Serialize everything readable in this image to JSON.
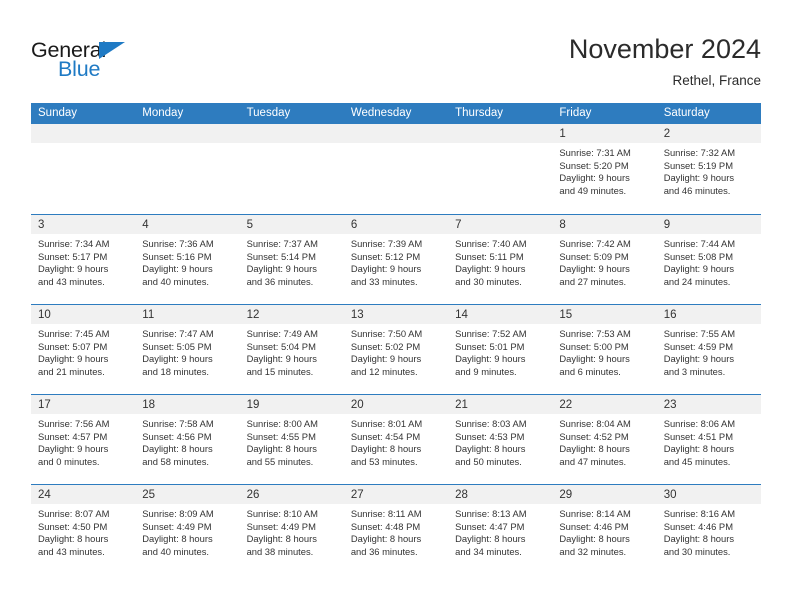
{
  "brand": {
    "name_part1": "General",
    "name_part2": "Blue",
    "accent_color": "#1f7ac4"
  },
  "header": {
    "title": "November 2024",
    "subtitle": "Rethel, France"
  },
  "colors": {
    "header_band": "#2e7cbf",
    "daynum_band": "#f1f1f1",
    "text": "#333333"
  },
  "weekdays": [
    "Sunday",
    "Monday",
    "Tuesday",
    "Wednesday",
    "Thursday",
    "Friday",
    "Saturday"
  ],
  "weeks": [
    [
      {
        "day": "",
        "lines": []
      },
      {
        "day": "",
        "lines": []
      },
      {
        "day": "",
        "lines": []
      },
      {
        "day": "",
        "lines": []
      },
      {
        "day": "",
        "lines": []
      },
      {
        "day": "1",
        "lines": [
          "Sunrise: 7:31 AM",
          "Sunset: 5:20 PM",
          "Daylight: 9 hours",
          "and 49 minutes."
        ]
      },
      {
        "day": "2",
        "lines": [
          "Sunrise: 7:32 AM",
          "Sunset: 5:19 PM",
          "Daylight: 9 hours",
          "and 46 minutes."
        ]
      }
    ],
    [
      {
        "day": "3",
        "lines": [
          "Sunrise: 7:34 AM",
          "Sunset: 5:17 PM",
          "Daylight: 9 hours",
          "and 43 minutes."
        ]
      },
      {
        "day": "4",
        "lines": [
          "Sunrise: 7:36 AM",
          "Sunset: 5:16 PM",
          "Daylight: 9 hours",
          "and 40 minutes."
        ]
      },
      {
        "day": "5",
        "lines": [
          "Sunrise: 7:37 AM",
          "Sunset: 5:14 PM",
          "Daylight: 9 hours",
          "and 36 minutes."
        ]
      },
      {
        "day": "6",
        "lines": [
          "Sunrise: 7:39 AM",
          "Sunset: 5:12 PM",
          "Daylight: 9 hours",
          "and 33 minutes."
        ]
      },
      {
        "day": "7",
        "lines": [
          "Sunrise: 7:40 AM",
          "Sunset: 5:11 PM",
          "Daylight: 9 hours",
          "and 30 minutes."
        ]
      },
      {
        "day": "8",
        "lines": [
          "Sunrise: 7:42 AM",
          "Sunset: 5:09 PM",
          "Daylight: 9 hours",
          "and 27 minutes."
        ]
      },
      {
        "day": "9",
        "lines": [
          "Sunrise: 7:44 AM",
          "Sunset: 5:08 PM",
          "Daylight: 9 hours",
          "and 24 minutes."
        ]
      }
    ],
    [
      {
        "day": "10",
        "lines": [
          "Sunrise: 7:45 AM",
          "Sunset: 5:07 PM",
          "Daylight: 9 hours",
          "and 21 minutes."
        ]
      },
      {
        "day": "11",
        "lines": [
          "Sunrise: 7:47 AM",
          "Sunset: 5:05 PM",
          "Daylight: 9 hours",
          "and 18 minutes."
        ]
      },
      {
        "day": "12",
        "lines": [
          "Sunrise: 7:49 AM",
          "Sunset: 5:04 PM",
          "Daylight: 9 hours",
          "and 15 minutes."
        ]
      },
      {
        "day": "13",
        "lines": [
          "Sunrise: 7:50 AM",
          "Sunset: 5:02 PM",
          "Daylight: 9 hours",
          "and 12 minutes."
        ]
      },
      {
        "day": "14",
        "lines": [
          "Sunrise: 7:52 AM",
          "Sunset: 5:01 PM",
          "Daylight: 9 hours",
          "and 9 minutes."
        ]
      },
      {
        "day": "15",
        "lines": [
          "Sunrise: 7:53 AM",
          "Sunset: 5:00 PM",
          "Daylight: 9 hours",
          "and 6 minutes."
        ]
      },
      {
        "day": "16",
        "lines": [
          "Sunrise: 7:55 AM",
          "Sunset: 4:59 PM",
          "Daylight: 9 hours",
          "and 3 minutes."
        ]
      }
    ],
    [
      {
        "day": "17",
        "lines": [
          "Sunrise: 7:56 AM",
          "Sunset: 4:57 PM",
          "Daylight: 9 hours",
          "and 0 minutes."
        ]
      },
      {
        "day": "18",
        "lines": [
          "Sunrise: 7:58 AM",
          "Sunset: 4:56 PM",
          "Daylight: 8 hours",
          "and 58 minutes."
        ]
      },
      {
        "day": "19",
        "lines": [
          "Sunrise: 8:00 AM",
          "Sunset: 4:55 PM",
          "Daylight: 8 hours",
          "and 55 minutes."
        ]
      },
      {
        "day": "20",
        "lines": [
          "Sunrise: 8:01 AM",
          "Sunset: 4:54 PM",
          "Daylight: 8 hours",
          "and 53 minutes."
        ]
      },
      {
        "day": "21",
        "lines": [
          "Sunrise: 8:03 AM",
          "Sunset: 4:53 PM",
          "Daylight: 8 hours",
          "and 50 minutes."
        ]
      },
      {
        "day": "22",
        "lines": [
          "Sunrise: 8:04 AM",
          "Sunset: 4:52 PM",
          "Daylight: 8 hours",
          "and 47 minutes."
        ]
      },
      {
        "day": "23",
        "lines": [
          "Sunrise: 8:06 AM",
          "Sunset: 4:51 PM",
          "Daylight: 8 hours",
          "and 45 minutes."
        ]
      }
    ],
    [
      {
        "day": "24",
        "lines": [
          "Sunrise: 8:07 AM",
          "Sunset: 4:50 PM",
          "Daylight: 8 hours",
          "and 43 minutes."
        ]
      },
      {
        "day": "25",
        "lines": [
          "Sunrise: 8:09 AM",
          "Sunset: 4:49 PM",
          "Daylight: 8 hours",
          "and 40 minutes."
        ]
      },
      {
        "day": "26",
        "lines": [
          "Sunrise: 8:10 AM",
          "Sunset: 4:49 PM",
          "Daylight: 8 hours",
          "and 38 minutes."
        ]
      },
      {
        "day": "27",
        "lines": [
          "Sunrise: 8:11 AM",
          "Sunset: 4:48 PM",
          "Daylight: 8 hours",
          "and 36 minutes."
        ]
      },
      {
        "day": "28",
        "lines": [
          "Sunrise: 8:13 AM",
          "Sunset: 4:47 PM",
          "Daylight: 8 hours",
          "and 34 minutes."
        ]
      },
      {
        "day": "29",
        "lines": [
          "Sunrise: 8:14 AM",
          "Sunset: 4:46 PM",
          "Daylight: 8 hours",
          "and 32 minutes."
        ]
      },
      {
        "day": "30",
        "lines": [
          "Sunrise: 8:16 AM",
          "Sunset: 4:46 PM",
          "Daylight: 8 hours",
          "and 30 minutes."
        ]
      }
    ]
  ]
}
